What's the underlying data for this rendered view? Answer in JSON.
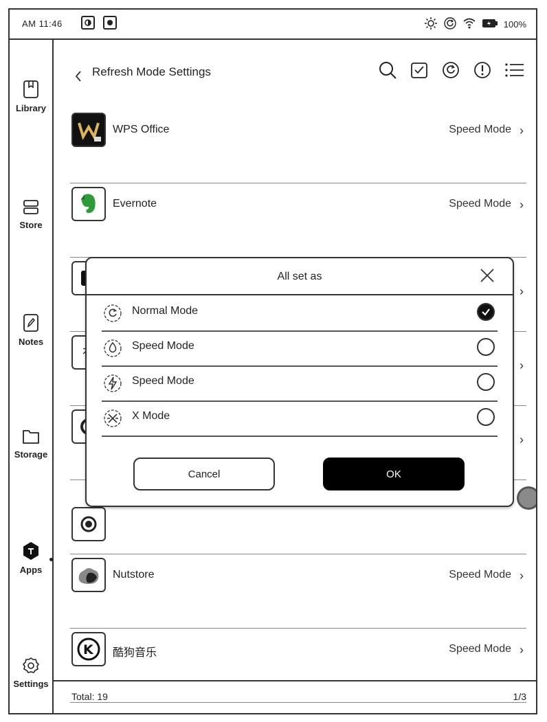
{
  "status_bar": {
    "time": "AM 11:46",
    "battery": "100%"
  },
  "sidebar": {
    "items": [
      {
        "label": "Library",
        "icon": "book-icon"
      },
      {
        "label": "Store",
        "icon": "store-icon"
      },
      {
        "label": "Notes",
        "icon": "notes-icon"
      },
      {
        "label": "Storage",
        "icon": "folder-icon"
      },
      {
        "label": "Apps",
        "icon": "apps-icon",
        "active": true
      },
      {
        "label": "Settings",
        "icon": "gear-icon"
      }
    ]
  },
  "header": {
    "title": "Refresh Mode Settings",
    "icons": [
      "search-icon",
      "checkbox-icon",
      "refresh-icon",
      "info-icon",
      "menu-icon"
    ]
  },
  "apps": [
    {
      "name": "WPS Office",
      "mode": "Speed Mode"
    },
    {
      "name": "Evernote",
      "mode": "Speed Mode"
    },
    {
      "name": "",
      "mode": ""
    },
    {
      "name": "",
      "mode": ""
    },
    {
      "name": "",
      "mode": ""
    },
    {
      "name": "",
      "mode": ""
    },
    {
      "name": "Nutstore",
      "mode": "Speed Mode"
    },
    {
      "name": "酷狗音乐",
      "mode": "Speed Mode"
    }
  ],
  "footer": {
    "total": "Total: 19",
    "page": "1/3"
  },
  "dialog": {
    "title": "All set as",
    "options": [
      {
        "label": "Normal Mode",
        "checked": true
      },
      {
        "label": "Speed Mode",
        "checked": false
      },
      {
        "label": "Speed Mode",
        "checked": false
      },
      {
        "label": "X Mode",
        "checked": false
      }
    ],
    "cancel_label": "Cancel",
    "ok_label": "OK"
  }
}
